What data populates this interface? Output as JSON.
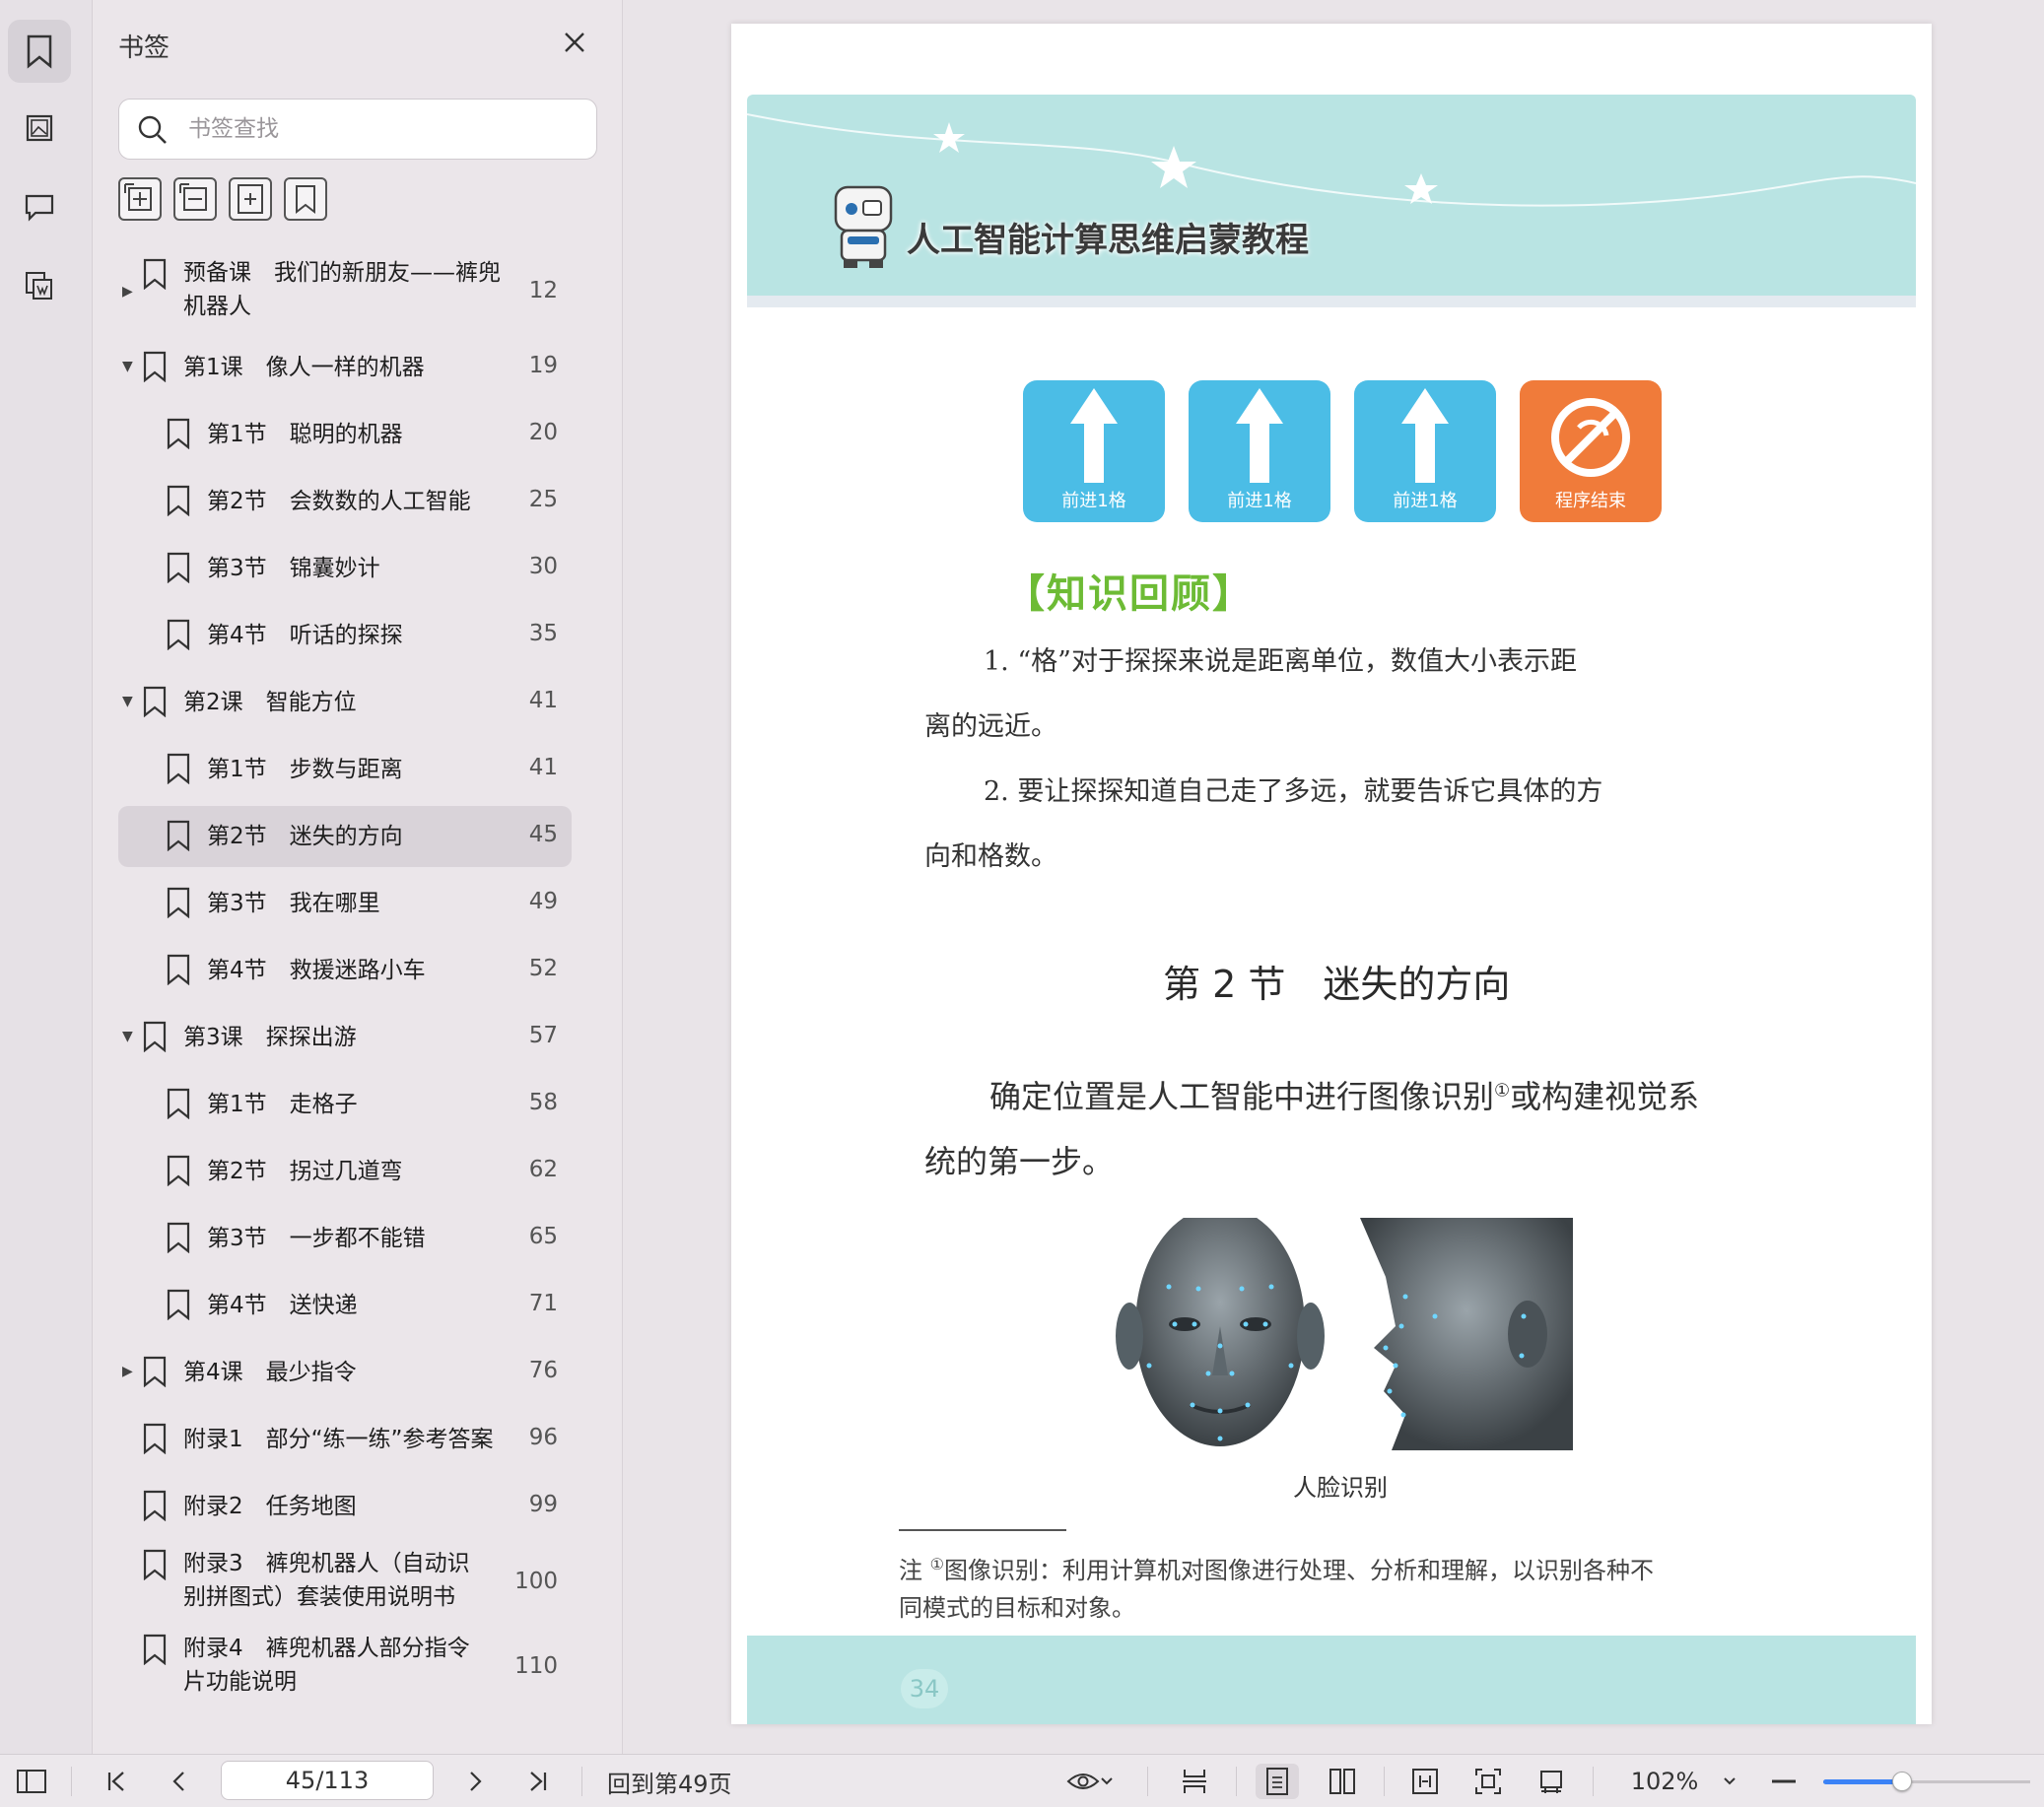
{
  "panel": {
    "title": "书签",
    "search_placeholder": "书签查找"
  },
  "bookmarks": [
    {
      "level": 0,
      "expander": "collapsed",
      "label": "预备课　我们的新朋友——裤兜",
      "label2": "机器人",
      "page": "12"
    },
    {
      "level": 0,
      "expander": "expanded",
      "label": "第1课　像人一样的机器",
      "page": "19"
    },
    {
      "level": 1,
      "label": "第1节　聪明的机器",
      "page": "20"
    },
    {
      "level": 1,
      "label": "第2节　会数数的人工智能",
      "page": "25"
    },
    {
      "level": 1,
      "label": "第3节　锦囊妙计",
      "page": "30"
    },
    {
      "level": 1,
      "label": "第4节　听话的探探",
      "page": "35"
    },
    {
      "level": 0,
      "expander": "expanded",
      "label": "第2课　智能方位",
      "page": "41"
    },
    {
      "level": 1,
      "label": "第1节　步数与距离",
      "page": "41"
    },
    {
      "level": 1,
      "label": "第2节　迷失的方向",
      "page": "45",
      "selected": true
    },
    {
      "level": 1,
      "label": "第3节　我在哪里",
      "page": "49"
    },
    {
      "level": 1,
      "label": "第4节　救援迷路小车",
      "page": "52"
    },
    {
      "level": 0,
      "expander": "expanded",
      "label": "第3课　探探出游",
      "page": "57"
    },
    {
      "level": 1,
      "label": "第1节　走格子",
      "page": "58"
    },
    {
      "level": 1,
      "label": "第2节　拐过几道弯",
      "page": "62"
    },
    {
      "level": 1,
      "label": "第3节　一步都不能错",
      "page": "65"
    },
    {
      "level": 1,
      "label": "第4节　送快递",
      "page": "71"
    },
    {
      "level": 0,
      "expander": "collapsed",
      "label": "第4课　最少指令",
      "page": "76"
    },
    {
      "level": 0,
      "label": "附录1　部分“练一练”参考答案",
      "page": "96"
    },
    {
      "level": 0,
      "label": "附录2　任务地图",
      "page": "99"
    },
    {
      "level": 0,
      "label": "附录3　裤兜机器人（自动识",
      "label2": "别拼图式）套装使用说明书",
      "page": "100"
    },
    {
      "level": 0,
      "label": "附录4　裤兜机器人部分指令",
      "label2": "片功能说明",
      "page": "110"
    }
  ],
  "document": {
    "banner_title": "人工智能计算思维启蒙教程",
    "commands": [
      {
        "label": "前进1格",
        "color": "#4bbde6",
        "icon": "arrow-up-icon"
      },
      {
        "label": "前进1格",
        "color": "#4bbde6",
        "icon": "arrow-up-icon"
      },
      {
        "label": "前进1格",
        "color": "#4bbde6",
        "icon": "arrow-up-icon"
      },
      {
        "label": "程序结束",
        "color": "#f07b3a",
        "icon": "program-end-icon"
      }
    ],
    "review_heading": "【知识回顾】",
    "review_p1_line1": "1. “格”对于探探来说是距离单位，数值大小表示距",
    "review_p1_line2": "离的远近。",
    "review_p2_line1": "2. 要让探探知道自己走了多远，就要告诉它具体的方",
    "review_p2_line2": "向和格数。",
    "section_title": "第 2 节　迷失的方向",
    "body_line1_a": "确定位置是人工智能中进行图像识别",
    "body_sup": "①",
    "body_line1_b": "或构建视觉系",
    "body_line2": "统的第一步。",
    "figure_caption": "人脸识别",
    "footnote_line1_a": "注 ",
    "footnote_sup": "①",
    "footnote_line1_b": "图像识别：利用计算机对图像进行处理、分析和理解，以识别各种不",
    "footnote_line2": "同模式的目标和对象。",
    "page_number": "34"
  },
  "toolbar": {
    "page_indicator": "45/113",
    "back_to": "回到第49页",
    "zoom": "102%",
    "zoom_slider_fraction": 0.38
  },
  "colors": {
    "teal": "#b9e4e3",
    "accent": "#3b82f6",
    "review_green": "#6dbb35"
  }
}
